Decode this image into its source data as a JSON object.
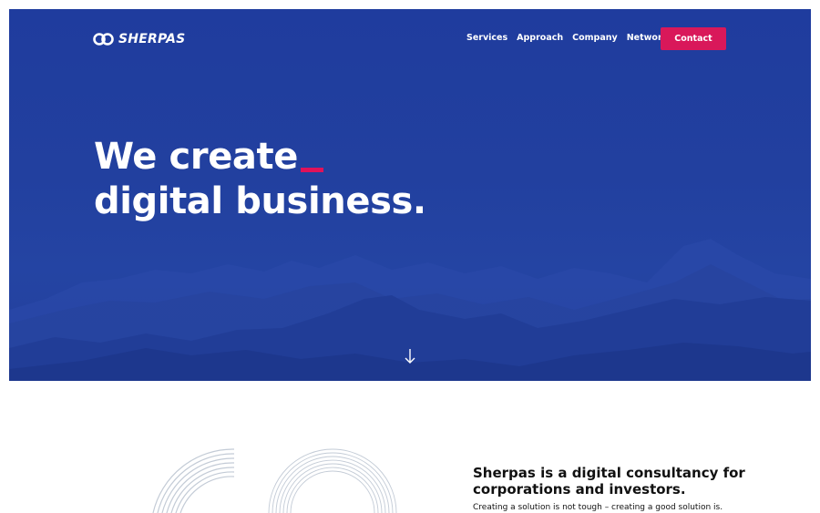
{
  "brand": {
    "name": "SHERPAS",
    "accent_color": "#d9185a",
    "hero_color": "#2241a2"
  },
  "nav": {
    "links": [
      {
        "label": "Services"
      },
      {
        "label": "Approach"
      },
      {
        "label": "Company"
      },
      {
        "label": "Network"
      }
    ],
    "contact_label": "Contact"
  },
  "hero": {
    "headline_line1": "We create",
    "headline_line2": "digital business.",
    "scroll_icon": "arrow-down-icon"
  },
  "about": {
    "title": "Sherpas is a digital consultancy for corporations and investors.",
    "text": "Creating a solution is not tough – creating a good solution is."
  }
}
